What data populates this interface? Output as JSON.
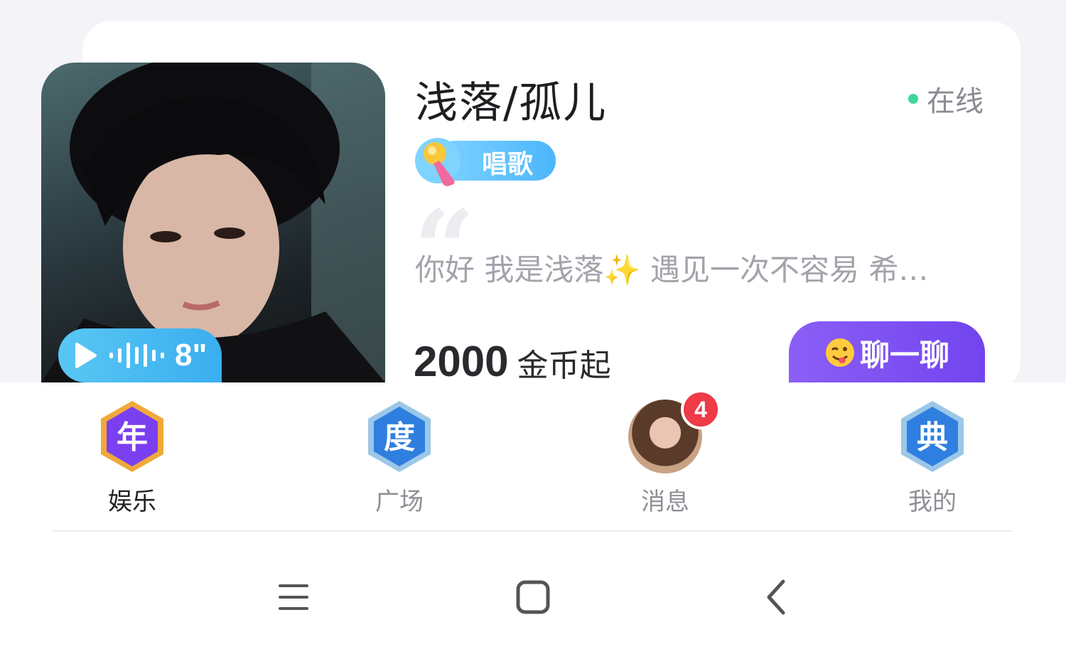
{
  "profile": {
    "name": "浅落/孤儿",
    "status": "在线",
    "tag": "唱歌",
    "bio": "你好 我是浅落✨ 遇见一次不容易 希…",
    "voice_duration": "8\"",
    "price_value": "2000",
    "price_unit": "金币起",
    "chat_button": "聊一聊"
  },
  "tabs": [
    {
      "label": "娱乐",
      "badge": "年",
      "active": true
    },
    {
      "label": "广场",
      "badge": "度",
      "active": false
    },
    {
      "label": "消息",
      "unread": "4",
      "active": false
    },
    {
      "label": "我的",
      "badge": "典",
      "active": false
    }
  ],
  "colors": {
    "online": "#3ed89a",
    "accent_purple": "#7a4cf0",
    "voice_blue": "#4ab9f2",
    "badge_red": "#ef3a47"
  },
  "icons": [
    "play-icon",
    "waveform-icon",
    "microphone-icon",
    "wink-emoji-icon",
    "menu-icon",
    "home-icon",
    "back-icon"
  ]
}
